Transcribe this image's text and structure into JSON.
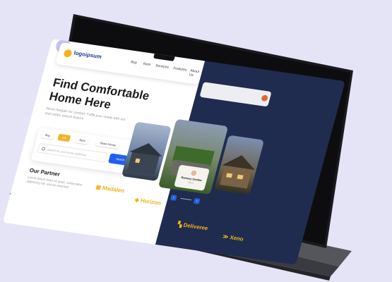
{
  "header": {
    "logo_text": "logoipsum",
    "nav": [
      "Buy",
      "Rent",
      "Services",
      "Features",
      "About Us"
    ]
  },
  "hero": {
    "title_line1": "Find Comfortable",
    "title_line2": "Home Here",
    "subtitle": "Never bargain for comfort. Fulfill your needs with our real estate search feature"
  },
  "search": {
    "chips": [
      "Buy",
      "Sell",
      "Rent",
      "Share House"
    ],
    "active_chip": "Sell",
    "placeholder": "Search for your future residence",
    "button": "Search"
  },
  "partners": {
    "title": "Our Partner",
    "subtitle": "Lorem ipsum dolor sit amet, consectetur adipiscing elit, sed do eiusmod",
    "logos": [
      "Madalen",
      "Horizon",
      "Deliveree",
      "Xeno"
    ]
  },
  "agent": {
    "name": "Ramsey Gamba",
    "role": "Agent"
  },
  "colors": {
    "background": "#e5e4f7",
    "accent_yellow": "#f4b41a",
    "primary_blue": "#2060f0",
    "dark_navy": "#1f2c4f"
  }
}
